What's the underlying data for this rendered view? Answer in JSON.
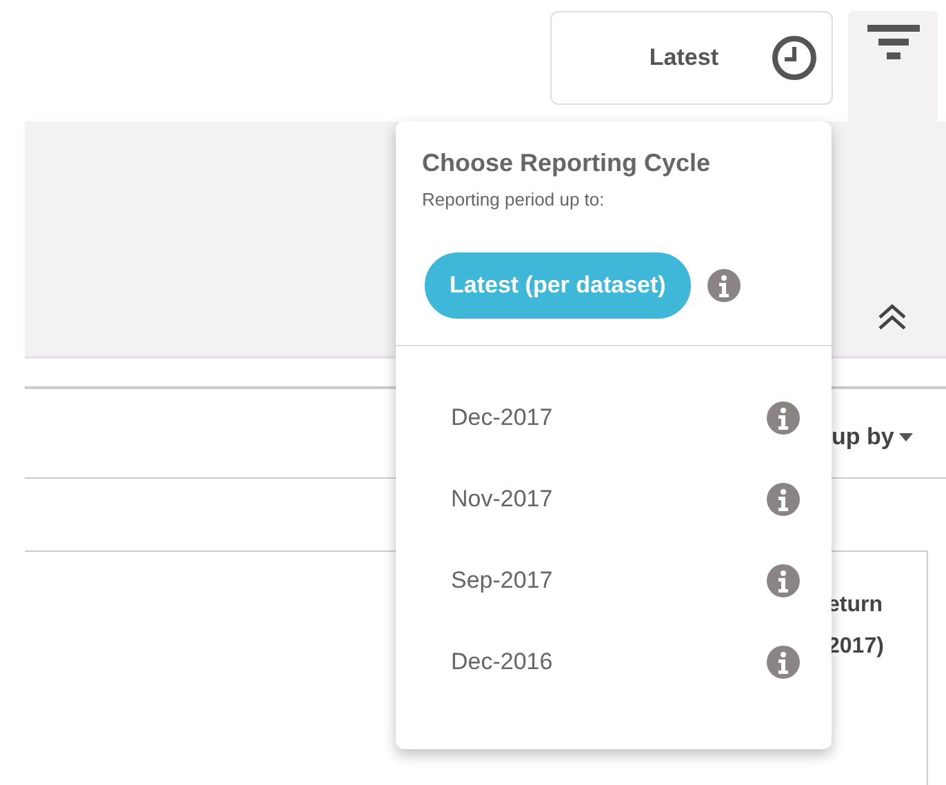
{
  "toolbar": {
    "cycle_button": {
      "label": "Latest"
    }
  },
  "popover": {
    "title": "Choose Reporting Cycle",
    "subtitle": "Reporting period up to:",
    "options": [
      {
        "label": "Latest (per dataset)",
        "kind": "pill",
        "selected": true
      },
      {
        "label": "Dec-2017",
        "kind": "item",
        "selected": false
      },
      {
        "label": "Nov-2017",
        "kind": "item",
        "selected": false
      },
      {
        "label": "Sep-2017",
        "kind": "item",
        "selected": false
      },
      {
        "label": "Dec-2016",
        "kind": "item",
        "selected": false
      }
    ]
  },
  "group_by": {
    "label": "up by"
  },
  "card": {
    "heading_lines": [
      "eturn",
      "2017)"
    ]
  }
}
